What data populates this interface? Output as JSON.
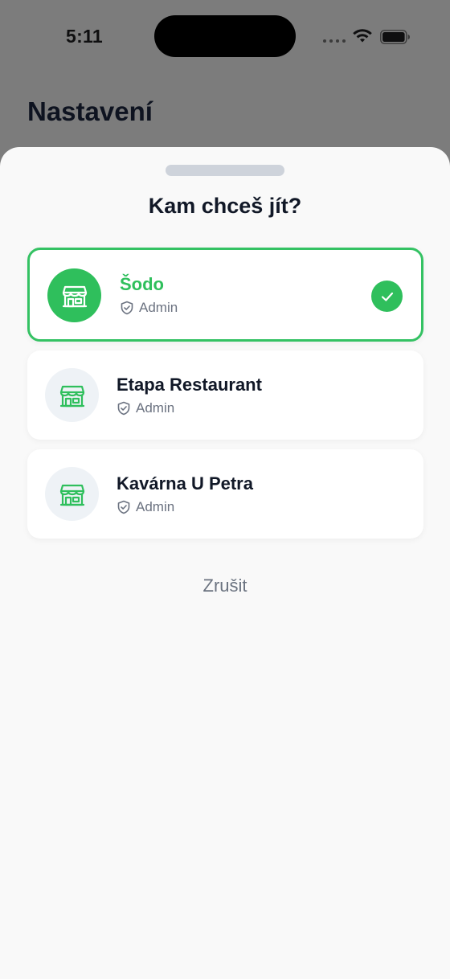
{
  "status_bar": {
    "time": "5:11"
  },
  "background": {
    "title": "Nastavení"
  },
  "sheet": {
    "title": "Kam chceš jít?",
    "options": [
      {
        "name": "Šodo",
        "role": "Admin",
        "selected": true,
        "icon": "store-icon"
      },
      {
        "name": "Etapa Restaurant",
        "role": "Admin",
        "selected": false,
        "icon": "store-icon"
      },
      {
        "name": "Kavárna U Petra",
        "role": "Admin",
        "selected": false,
        "icon": "store-icon"
      }
    ],
    "cancel_label": "Zrušit"
  },
  "colors": {
    "accent": "#2fbf5c",
    "text_primary": "#111827",
    "text_secondary": "#6b7280",
    "sheet_background": "#f9f9f9",
    "overlay": "#7c7c7c"
  }
}
